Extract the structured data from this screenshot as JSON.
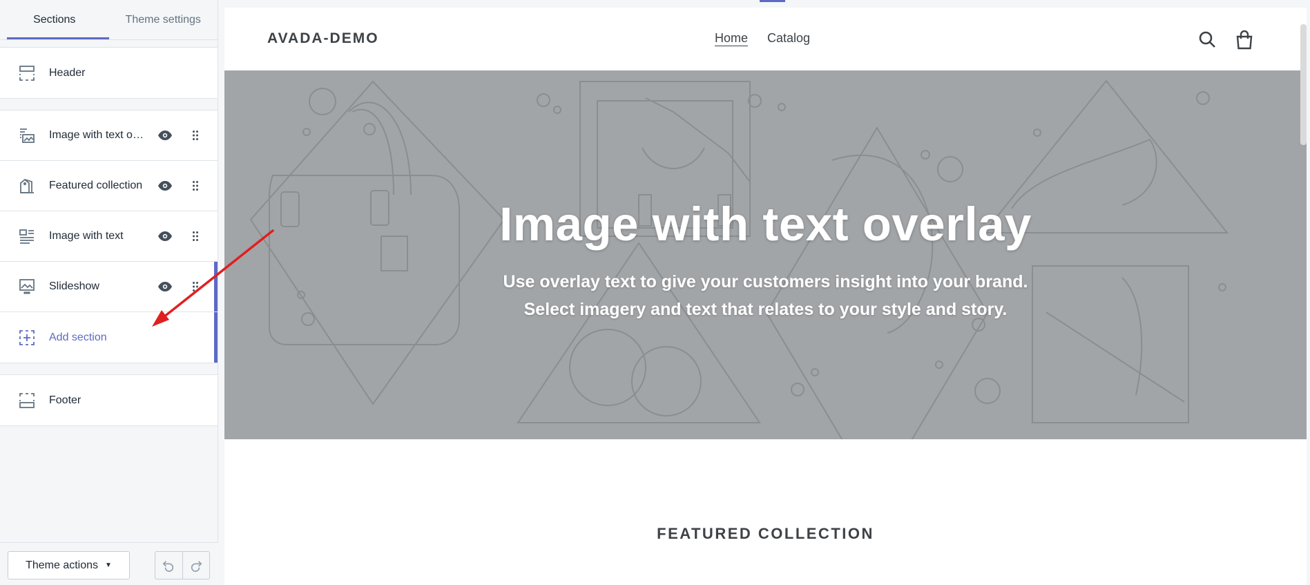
{
  "sidebar": {
    "tabs": [
      {
        "label": "Sections",
        "active": true
      },
      {
        "label": "Theme settings",
        "active": false
      }
    ],
    "header_item": {
      "label": "Header",
      "icon": "header-layout-icon"
    },
    "sections": [
      {
        "label": "Image with text overlay",
        "icon": "image-text-overlay-icon"
      },
      {
        "label": "Featured collection",
        "icon": "collection-icon"
      },
      {
        "label": "Image with text",
        "icon": "image-with-text-icon"
      },
      {
        "label": "Slideshow",
        "icon": "slideshow-icon"
      }
    ],
    "add_section": {
      "label": "Add section",
      "icon": "add-section-icon"
    },
    "footer_item": {
      "label": "Footer",
      "icon": "footer-layout-icon"
    },
    "theme_actions_label": "Theme actions"
  },
  "store": {
    "logo": "AVADA-DEMO",
    "nav": [
      {
        "label": "Home",
        "active": true
      },
      {
        "label": "Catalog",
        "active": false
      }
    ],
    "hero": {
      "title": "Image with text overlay",
      "subtitle_line1": "Use overlay text to give your customers insight into your brand.",
      "subtitle_line2": "Select imagery and text that relates to your style and story."
    },
    "featured_heading": "FEATURED COLLECTION"
  },
  "colors": {
    "accent": "#5c6ac4",
    "hero_bg": "#a2a5a8",
    "annotation_arrow": "#e02020"
  }
}
